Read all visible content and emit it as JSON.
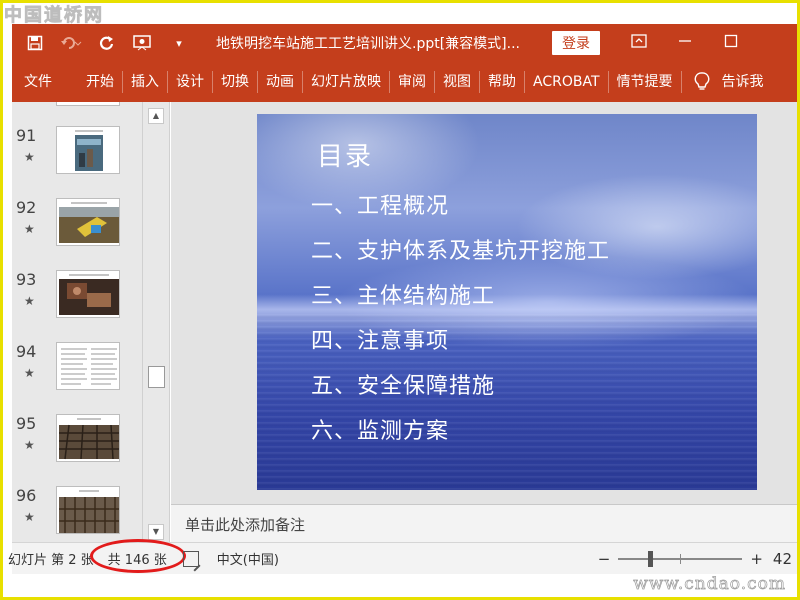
{
  "watermark": {
    "top": "中国道桥网",
    "bottom": "www.cndao.com"
  },
  "titlebar": {
    "doc_title": "地铁明挖车站施工工艺培训讲义.ppt[兼容模式]...",
    "login_label": "登录",
    "icons": [
      "save-icon",
      "undo-icon",
      "redo-icon",
      "present-icon",
      "customize-icon"
    ],
    "window_buttons": [
      "ribbon-display-icon",
      "minimize-icon",
      "maximize-icon"
    ]
  },
  "ribbon": {
    "tabs": [
      "文件",
      "开始",
      "插入",
      "设计",
      "切换",
      "动画",
      "幻灯片放映",
      "审阅",
      "视图",
      "帮助",
      "ACROBAT",
      "情节提要"
    ],
    "tellme": "告诉我"
  },
  "thumbnails": [
    {
      "number": "91"
    },
    {
      "number": "92"
    },
    {
      "number": "93"
    },
    {
      "number": "94"
    },
    {
      "number": "95"
    },
    {
      "number": "96"
    }
  ],
  "slide": {
    "title": "目录",
    "items": [
      "一、工程概况",
      "二、支护体系及基坑开挖施工",
      "三、主体结构施工",
      "四、注意事项",
      "五、安全保障措施",
      "六、监测方案"
    ]
  },
  "notes": {
    "placeholder": "单击此处添加备注"
  },
  "statusbar": {
    "slide_position": "幻灯片 第 2 张",
    "slide_count": "共 146 张",
    "language": "中文(中国)",
    "zoom_level": "42"
  },
  "colors": {
    "accent": "#c43e1c",
    "highlight": "#e21b1b",
    "frame": "#e8e000"
  }
}
